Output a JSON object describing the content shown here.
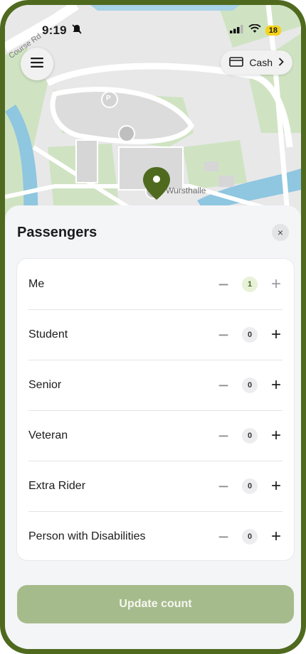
{
  "status_bar": {
    "time": "9:19",
    "battery": "18"
  },
  "map": {
    "street_label": "Course Rd",
    "place_label": "Wursthalle",
    "parking_label": "P"
  },
  "top": {
    "payment_label": "Cash"
  },
  "sheet": {
    "title": "Passengers",
    "close_glyph": "×",
    "rows": [
      {
        "label": "Me",
        "count": "1"
      },
      {
        "label": "Student",
        "count": "0"
      },
      {
        "label": "Senior",
        "count": "0"
      },
      {
        "label": "Veteran",
        "count": "0"
      },
      {
        "label": "Extra Rider",
        "count": "0"
      },
      {
        "label": "Person with Disabilities",
        "count": "0"
      }
    ],
    "update_button": "Update count"
  },
  "colors": {
    "brand": "#4f6a1f",
    "button_disabled": "#a6bb8c",
    "active_count_bg": "#e8f2d9"
  }
}
